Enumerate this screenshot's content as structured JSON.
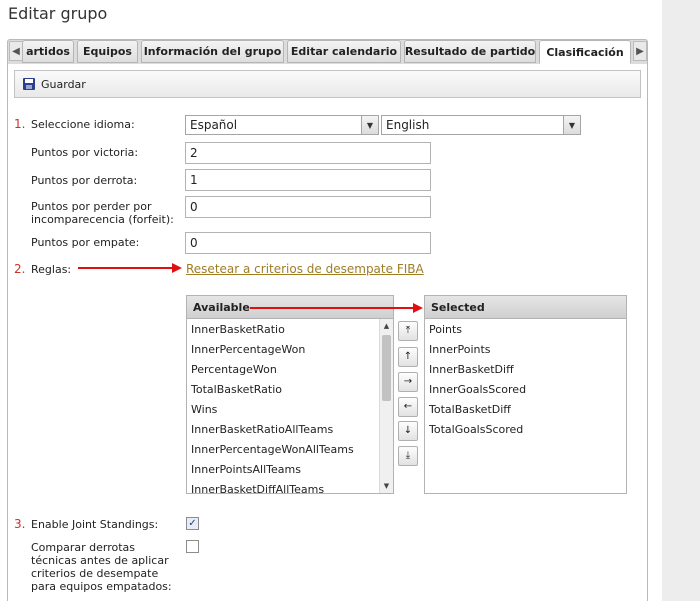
{
  "page": {
    "title": "Editar grupo"
  },
  "tabs": [
    {
      "label": "artidos"
    },
    {
      "label": "Equipos"
    },
    {
      "label": "Información del grupo"
    },
    {
      "label": "Editar calendario"
    },
    {
      "label": "Resultado de partido"
    },
    {
      "label": "Clasificación",
      "active": true
    }
  ],
  "toolbar": {
    "save_label": "Guardar"
  },
  "form": {
    "language": {
      "number": "1.",
      "label": "Seleccione idioma:",
      "primary": "Español",
      "secondary": "English"
    },
    "points_win": {
      "label": "Puntos por victoria:",
      "value": "2"
    },
    "points_loss": {
      "label": "Puntos por derrota:",
      "value": "1"
    },
    "points_forfeit": {
      "label": "Puntos por perder por incomparecencia (forfeit):",
      "value": "0"
    },
    "points_draw": {
      "label": "Puntos por empate:",
      "value": "0"
    },
    "rules": {
      "number": "2.",
      "label": "Reglas:",
      "reset_link": "Resetear a criterios de desempate FIBA"
    },
    "joint": {
      "number": "3.",
      "label": "Enable Joint Standings:",
      "checked": true
    },
    "compare": {
      "label": "Comparar derrotas técnicas antes de aplicar criterios de desempate para equipos empatados:",
      "checked": false
    }
  },
  "lists": {
    "available": {
      "header": "Available",
      "items": [
        "InnerBasketRatio",
        "InnerPercentageWon",
        "PercentageWon",
        "TotalBasketRatio",
        "Wins",
        "InnerBasketRatioAllTeams",
        "InnerPercentageWonAllTeams",
        "InnerPointsAllTeams",
        "InnerBasketDiffAllTeams"
      ]
    },
    "selected": {
      "header": "Selected",
      "items": [
        "Points",
        "InnerPoints",
        "InnerBasketDiff",
        "InnerGoalsScored",
        "TotalBasketDiff",
        "TotalGoalsScored"
      ]
    }
  },
  "icons": {
    "tab_prev": "◀",
    "tab_next": "▶",
    "dropdown": "▼",
    "scroll_up": "▲",
    "scroll_down": "▼",
    "move_top": "⤒",
    "move_up": "↑",
    "move_right": "→",
    "move_left": "←",
    "move_down": "↓",
    "move_bottom": "⤓",
    "check": "✓"
  },
  "colors": {
    "number_red": "#d0302a",
    "annotation_arrow": "#e01010",
    "link": "#9e7d25"
  }
}
